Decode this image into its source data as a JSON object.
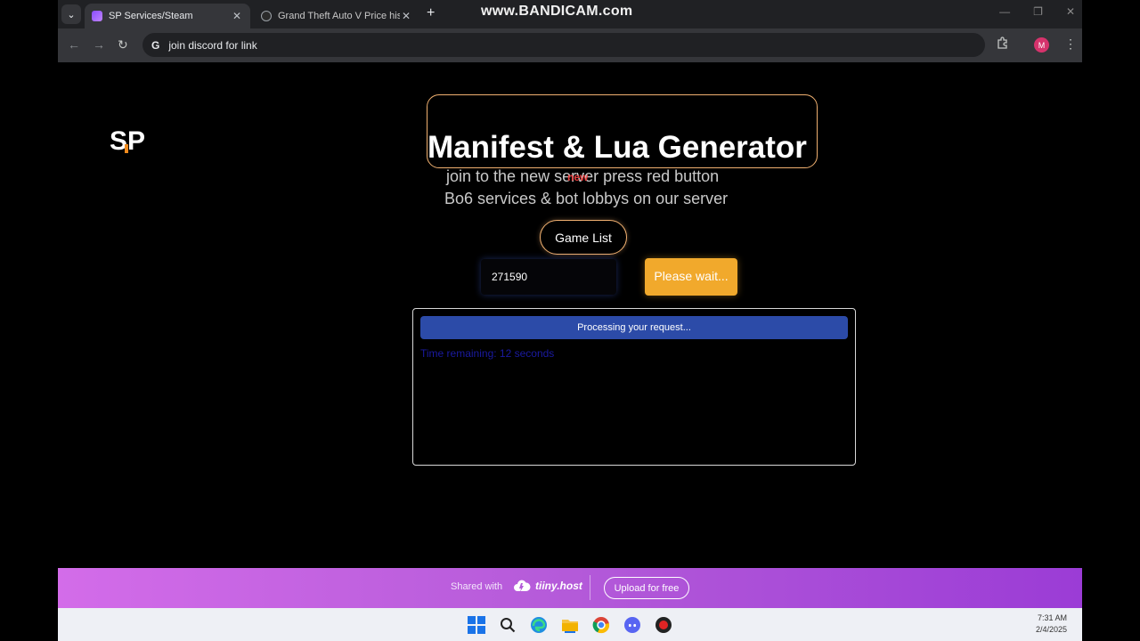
{
  "browser": {
    "tabs": [
      {
        "title": "SP Services/Steam",
        "active": true
      },
      {
        "title": "Grand Theft Auto V Price history",
        "active": false
      }
    ],
    "close_glyph": "✕",
    "new_tab_glyph": "+",
    "address": "join discord for link",
    "search_engine_glyph": "G",
    "profile_initial": "M",
    "recording_watermark": "www.BANDICAM.com"
  },
  "page": {
    "logo_text": "SP",
    "title": "Manifest & Lua Generator",
    "subtitle_1": "join to the new server press red button",
    "subtitle_1_overlay": "new",
    "subtitle_2": "Bo6 services & bot lobbys on our server",
    "game_list_button": "Game List",
    "app_id_value": "271590",
    "submit_button": "Please wait...",
    "progress_text": "Processing your request...",
    "time_remaining": "Time remaining: 12 seconds"
  },
  "share_bar": {
    "shared_with": "Shared with",
    "brand": "tiiny.host",
    "upload_button": "Upload for free"
  },
  "taskbar": {
    "time": "7:31 AM",
    "date": "2/4/2025",
    "apps": [
      "windows-start",
      "search",
      "edge",
      "file-explorer",
      "chrome",
      "discord",
      "bandicam"
    ]
  },
  "colors": {
    "accent_orange": "#f0b070",
    "button_orange": "#f1a92c",
    "progress_blue": "#2c4ba8",
    "share_gradient_start": "#d36ce9",
    "share_gradient_end": "#9b3cd6"
  }
}
